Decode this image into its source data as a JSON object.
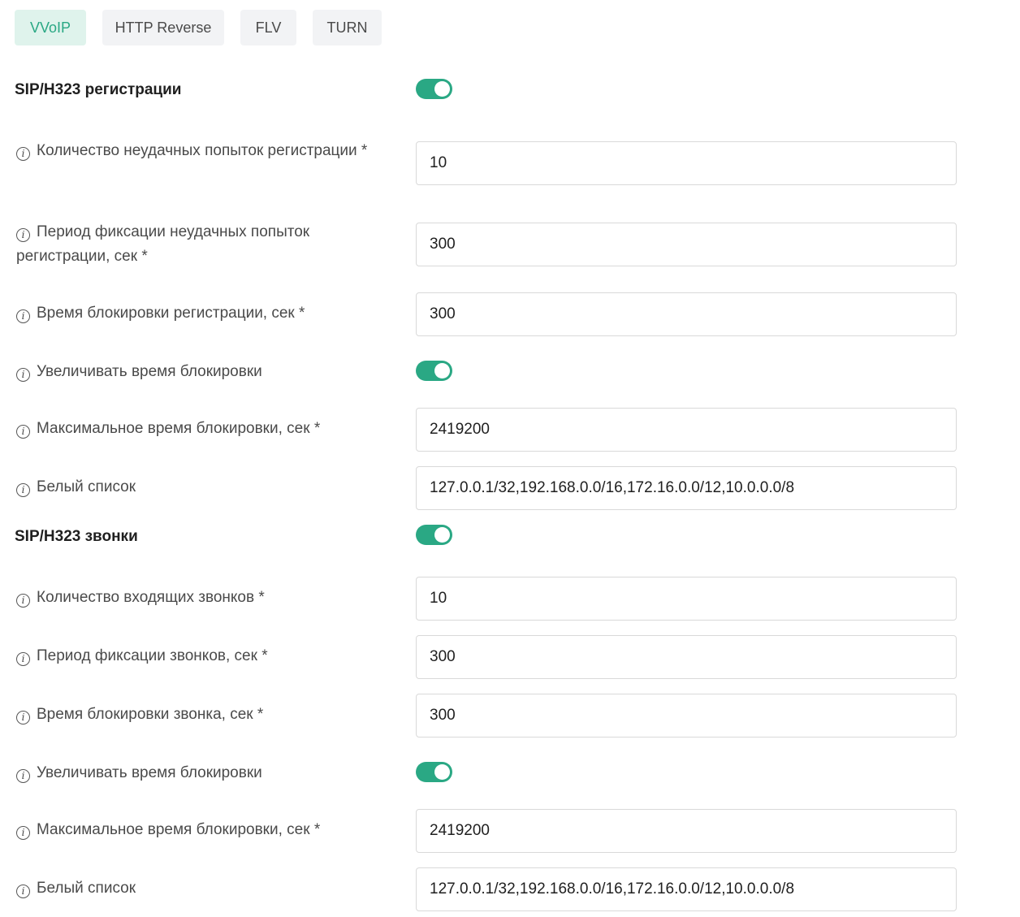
{
  "tabs": [
    {
      "label": "VVoIP",
      "active": true
    },
    {
      "label": "HTTP Reverse",
      "active": false
    },
    {
      "label": "FLV",
      "active": false
    },
    {
      "label": "TURN",
      "active": false
    }
  ],
  "colors": {
    "accent": "#2aa884",
    "active_tab_bg": "#dff3ec",
    "tab_bg": "#f2f3f5"
  },
  "registration": {
    "title": "SIP/H323 регистрации",
    "enabled": true,
    "failed_attempts": {
      "label": "Количество неудачных попыток регистрации *",
      "value": "10"
    },
    "attempts_period": {
      "label": "Период фиксации неудачных попыток регистрации, сек *",
      "value": "300"
    },
    "block_time": {
      "label": "Время блокировки регистрации, сек *",
      "value": "300"
    },
    "increase_block": {
      "label": "Увеличивать время блокировки",
      "enabled": true
    },
    "max_block_time": {
      "label": "Максимальное время блокировки, сек *",
      "value": "2419200"
    },
    "whitelist": {
      "label": "Белый список",
      "value": "127.0.0.1/32,192.168.0.0/16,172.16.0.0/12,10.0.0.0/8"
    }
  },
  "calls": {
    "title": "SIP/H323 звонки",
    "enabled": true,
    "incoming_count": {
      "label": "Количество входящих звонков *",
      "value": "10"
    },
    "calls_period": {
      "label": "Период фиксации звонков, сек *",
      "value": "300"
    },
    "block_time": {
      "label": "Время блокировки звонка, сек *",
      "value": "300"
    },
    "increase_block": {
      "label": "Увеличивать время блокировки",
      "enabled": true
    },
    "max_block_time": {
      "label": "Максимальное время блокировки, сек *",
      "value": "2419200"
    },
    "whitelist": {
      "label": "Белый список",
      "value": "127.0.0.1/32,192.168.0.0/16,172.16.0.0/12,10.0.0.0/8"
    }
  }
}
